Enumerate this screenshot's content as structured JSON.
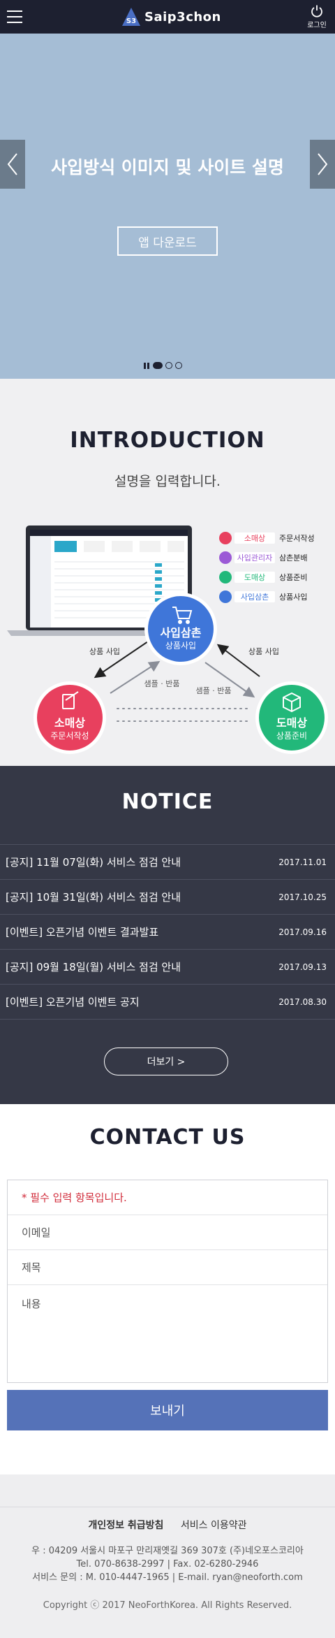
{
  "header": {
    "logo_badge": "S3",
    "logo_text": "Saip3chon",
    "login_label": "로그인"
  },
  "hero": {
    "title": "사입방식 이미지 및 사이트 설명",
    "button_label": "앱 다운로드",
    "background_color": "#a5bdd5",
    "slide_count": 3,
    "active_slide": 1
  },
  "intro": {
    "title": "INTRODUCTION",
    "subtitle": "설명을 입력합니다.",
    "legend": [
      {
        "role": "소매상",
        "desc": "주문서작성",
        "color": "#e8405e"
      },
      {
        "role": "사입관리자",
        "desc": "삼촌분배",
        "color": "#9b59d6"
      },
      {
        "role": "도매상",
        "desc": "상품준비",
        "color": "#22b87a"
      },
      {
        "role": "사입삼촌",
        "desc": "상품사입",
        "color": "#3f76d9"
      }
    ],
    "center_node": {
      "name": "사입삼촌",
      "desc": "상품사입"
    },
    "left_node": {
      "name": "소매상",
      "desc": "주문서작성"
    },
    "right_node": {
      "name": "도매상",
      "desc": "상품준비"
    },
    "arrow_labels": {
      "left_top": "상품 사입",
      "right_top": "상품 사입",
      "left_mid": "샘플 · 반품",
      "right_mid": "샘플 · 반품"
    }
  },
  "notice": {
    "title": "NOTICE",
    "items": [
      {
        "title": "[공지] 11월 07일(화) 서비스 점검 안내",
        "date": "2017.11.01"
      },
      {
        "title": "[공지] 10월 31일(화) 서비스 점검 안내",
        "date": "2017.10.25"
      },
      {
        "title": "[이벤트] 오픈기념 이벤트 결과발표",
        "date": "2017.09.16"
      },
      {
        "title": "[공지] 09월 18일(월) 서비스 점검 안내",
        "date": "2017.09.13"
      },
      {
        "title": "[이벤트] 오픈기념 이벤트 공지",
        "date": "2017.08.30"
      }
    ],
    "more_label": "더보기 >"
  },
  "contact": {
    "title": "CONTACT US",
    "required_note": "* 필수 입력 항목입니다.",
    "email_placeholder": "이메일",
    "subject_placeholder": "제목",
    "content_placeholder": "내용",
    "send_label": "보내기",
    "accent_color": "#5572b8"
  },
  "footer": {
    "privacy_label": "개인정보 취급방침",
    "terms_label": "서비스 이용약관",
    "address": "우 : 04209 서울시 마포구 만리재옛길 369 307호 (주)네오포스코리아",
    "tel_fax": "Tel. 070-8638-2997   |   Fax. 02-6280-2946",
    "inquiry": "서비스 문의 : M. 010-4447-1965   |   E-mail. ryan@neoforth.com",
    "copyright": "Copyright ⓒ 2017 NeoForthKorea. All Rights Reserved."
  }
}
